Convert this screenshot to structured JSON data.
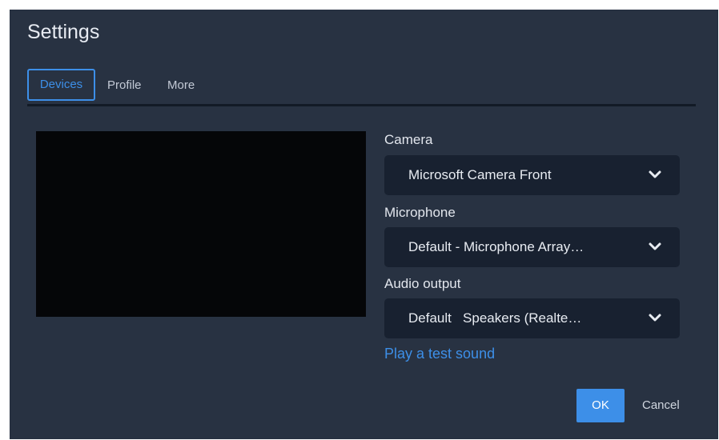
{
  "dialog": {
    "title": "Settings"
  },
  "tabs": [
    {
      "label": "Devices",
      "active": true
    },
    {
      "label": "Profile",
      "active": false
    },
    {
      "label": "More",
      "active": false
    }
  ],
  "devices": {
    "camera": {
      "label": "Camera",
      "value": "Microsoft Camera Front",
      "icon": "chevron-down-icon"
    },
    "microphone": {
      "label": "Microphone",
      "value": "Default - Microphone Array…",
      "icon": "chevron-down-icon"
    },
    "audio_output": {
      "label": "Audio output",
      "value": "Default   Speakers (Realte…",
      "icon": "chevron-down-icon"
    },
    "test_sound_link": "Play a test sound"
  },
  "footer": {
    "ok_label": "OK",
    "cancel_label": "Cancel"
  },
  "colors": {
    "dialog_bg": "#283242",
    "select_bg": "#182130",
    "accent": "#3d8fe8",
    "video_bg": "#050608"
  }
}
